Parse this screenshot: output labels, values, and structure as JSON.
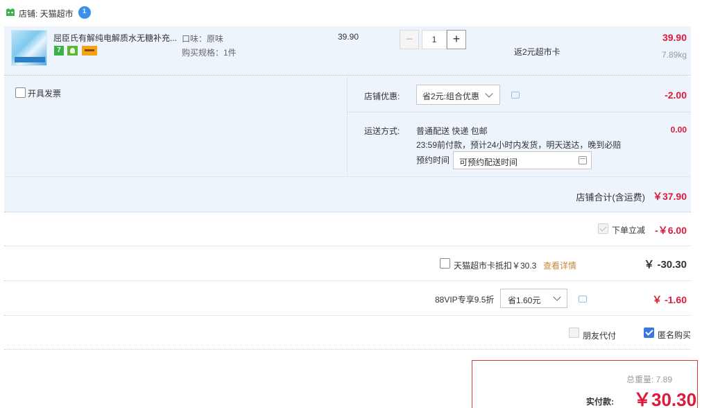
{
  "shop": {
    "label": "店铺: 天猫超市",
    "chat_badge": "1"
  },
  "item": {
    "title": "屈臣氏有解纯电解质水无糖补充...",
    "badge_seven": "7",
    "flavor": "口味：原味",
    "spec": "购买规格：1件",
    "unit_price": "39.90",
    "qty_minus": "−",
    "quantity": "1",
    "qty_plus": "+",
    "rebate": "返2元超市卡",
    "total": "39.90",
    "weight": "7.89kg"
  },
  "invoice": {
    "label": "开具发票"
  },
  "discount": {
    "label": "店铺优惠:",
    "selected": "省2元:组合优惠",
    "amount": "-2.00"
  },
  "shipping": {
    "label": "运送方式:",
    "method": "普通配送 快递 包邮",
    "desc": "23:59前付款，预计24小时内发货，明天送达，晚到必赔",
    "appoint_label": "预约时间",
    "appoint_value": "可预约配送时间",
    "amount": "0.00"
  },
  "shop_subtotal": {
    "label": "店铺合计(含运费)",
    "amount": "￥37.90"
  },
  "instant": {
    "label": "下单立减",
    "amount": "-￥6.00"
  },
  "card": {
    "label": "天猫超市卡抵扣￥30.3",
    "detail_link": "查看详情",
    "amount": "￥ -30.30"
  },
  "vip": {
    "label": "88VIP专享9.5折",
    "selected": "省1.60元",
    "amount": "￥ -1.60"
  },
  "options": {
    "friend_pay": "朋友代付",
    "anonymous": "匿名购买"
  },
  "payment": {
    "weight": "总重量: 7.89",
    "label": "实付款:",
    "amount": "￥30.30"
  },
  "colors": {
    "price_red": "#dd1a3a",
    "panel_blue": "#eef4fc",
    "link_orange": "#c8873a",
    "check_blue": "#3c76e0"
  }
}
